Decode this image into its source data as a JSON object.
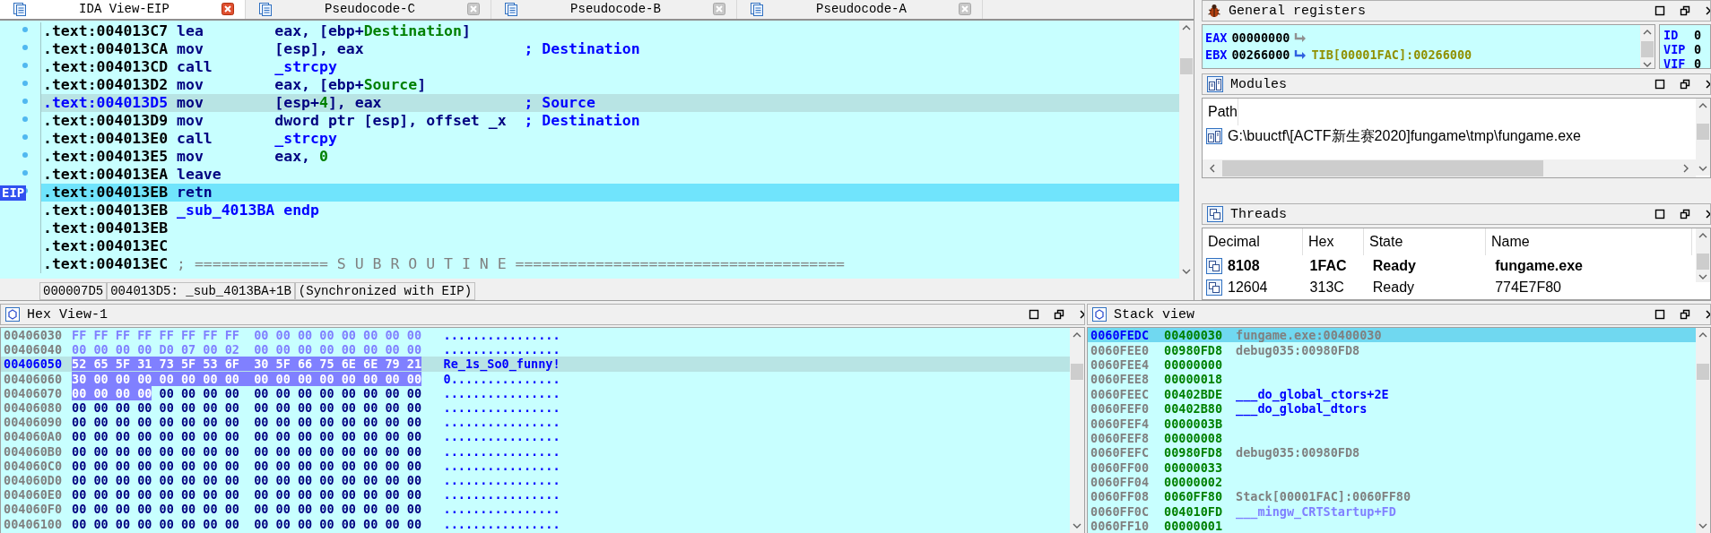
{
  "ida_view": {
    "tabs": [
      {
        "label": "IDA View-EIP",
        "selected": true
      },
      {
        "label": "Pseudocode-C",
        "selected": false
      },
      {
        "label": "Pseudocode-B",
        "selected": false
      },
      {
        "label": "Pseudocode-A",
        "selected": false
      }
    ],
    "eip_label": "EIP",
    "lines": [
      {
        "address": ".text:004013C7",
        "mnemonic": "lea",
        "kind": "instruction",
        "operands": [
          {
            "text": "eax, [ebp+",
            "kind": "plain"
          },
          {
            "text": "Destination",
            "kind": "name"
          },
          {
            "text": "]",
            "kind": "plain"
          }
        ],
        "marked": true,
        "selected": false,
        "current": false
      },
      {
        "address": ".text:004013CA",
        "mnemonic": "mov",
        "kind": "instruction",
        "operands": [
          {
            "text": "[esp], eax",
            "kind": "plain"
          }
        ],
        "comment": "; Destination",
        "marked": true,
        "selected": false,
        "current": false
      },
      {
        "address": ".text:004013CD",
        "mnemonic": "call",
        "kind": "instruction",
        "operands": [
          {
            "text": "_strcpy",
            "kind": "ref"
          }
        ],
        "marked": true,
        "selected": false,
        "current": false
      },
      {
        "address": ".text:004013D2",
        "mnemonic": "mov",
        "kind": "instruction",
        "operands": [
          {
            "text": "eax, [ebp+",
            "kind": "plain"
          },
          {
            "text": "Source",
            "kind": "name"
          },
          {
            "text": "]",
            "kind": "plain"
          }
        ],
        "marked": true,
        "selected": false,
        "current": false
      },
      {
        "address": ".text:004013D5",
        "mnemonic": "mov",
        "kind": "instruction",
        "operands": [
          {
            "text": "[esp+",
            "kind": "plain"
          },
          {
            "text": "4",
            "kind": "num"
          },
          {
            "text": "], eax",
            "kind": "plain"
          }
        ],
        "comment": "; Source",
        "marked": true,
        "selected": true,
        "current": false
      },
      {
        "address": ".text:004013D9",
        "mnemonic": "mov",
        "kind": "instruction",
        "operands": [
          {
            "text": "dword ptr [esp], offset _x",
            "kind": "plain"
          }
        ],
        "comment": "; Destination",
        "marked": true,
        "selected": false,
        "current": false
      },
      {
        "address": ".text:004013E0",
        "mnemonic": "call",
        "kind": "instruction",
        "operands": [
          {
            "text": "_strcpy",
            "kind": "ref"
          }
        ],
        "marked": true,
        "selected": false,
        "current": false
      },
      {
        "address": ".text:004013E5",
        "mnemonic": "mov",
        "kind": "instruction",
        "operands": [
          {
            "text": "eax, ",
            "kind": "plain"
          },
          {
            "text": "0",
            "kind": "num"
          }
        ],
        "marked": true,
        "selected": false,
        "current": false
      },
      {
        "address": ".text:004013EA",
        "mnemonic": "leave",
        "kind": "instruction",
        "marked": true,
        "selected": false,
        "current": false
      },
      {
        "address": ".text:004013EB",
        "mnemonic": "retn",
        "kind": "instruction",
        "marked": true,
        "selected": false,
        "current": true
      },
      {
        "address": ".text:004013EB",
        "mnemonic": "_sub_4013BA endp",
        "kind": "label",
        "marked": false,
        "selected": false,
        "current": false
      },
      {
        "address": ".text:004013EB",
        "marked": false,
        "selected": false,
        "current": false
      },
      {
        "address": ".text:004013EC",
        "marked": false,
        "selected": false,
        "current": false
      },
      {
        "address": ".text:004013EC",
        "mnemonic": "; =============== S U B R O U T I N E =====================================",
        "kind": "separator",
        "marked": false,
        "selected": false,
        "current": false
      }
    ],
    "status": [
      "000007D5",
      "004013D5: _sub_4013BA+1B",
      "(Synchronized with EIP)"
    ]
  },
  "registers": {
    "title": "General registers",
    "rows": [
      {
        "name": "EAX",
        "value": "00000000",
        "pointer": false
      },
      {
        "name": "EBX",
        "value": "00266000",
        "pointer": true,
        "target": "TIB[00001FAC]:00266000"
      }
    ],
    "flags": [
      {
        "name": "ID",
        "value": "0"
      },
      {
        "name": "VIP",
        "value": "0"
      },
      {
        "name": "VIF",
        "value": "0"
      }
    ]
  },
  "modules": {
    "title": "Modules",
    "columns": [
      "Path"
    ],
    "rows": [
      {
        "path": "G:\\buuctf\\[ACTF新生赛2020]fungame\\tmp\\fungame.exe"
      }
    ]
  },
  "threads": {
    "title": "Threads",
    "columns": [
      "Decimal",
      "Hex",
      "State",
      "Name"
    ],
    "rows": [
      {
        "cells": [
          "8108",
          "1FAC",
          "Ready",
          "fungame.exe"
        ],
        "current": true
      },
      {
        "cells": [
          "12604",
          "313C",
          "Ready",
          "774E7F80"
        ],
        "current": false
      }
    ]
  },
  "hex_view": {
    "title": "Hex View-1",
    "rows": [
      {
        "address": "00406030",
        "kind": "undefined",
        "groups": [
          {
            "text": "FF FF FF FF FF FF FF FF  00 00 00 00 00 00 00 00",
            "highlighted": false
          }
        ],
        "ascii": "................",
        "selected": false
      },
      {
        "address": "00406040",
        "kind": "undefined",
        "groups": [
          {
            "text": "00 00 00 00 D0 07 00 02  00 00 00 00 00 00 00 00",
            "highlighted": false
          }
        ],
        "ascii": "................",
        "selected": false
      },
      {
        "address": "00406050",
        "kind": "data",
        "groups": [
          {
            "text": "52 65 5F 31 73 5F 53 6F  30 5F 66 75 6E 6E 79 21",
            "highlighted": true
          }
        ],
        "ascii": "Re_1s_So0_funny!",
        "selected": true
      },
      {
        "address": "00406060",
        "kind": "data",
        "groups": [
          {
            "text": "30 00 00 00 00 00 00 00  00 00 00 00 00 00 00 00",
            "highlighted": true
          }
        ],
        "ascii": "0...............",
        "selected": false
      },
      {
        "address": "00406070",
        "kind": "data",
        "groups": [
          {
            "text": "00 00 00 00",
            "highlighted": true
          },
          {
            "text": "00 00 00 00  00 00 00 00 00 00 00 00",
            "highlighted": false
          }
        ],
        "ascii": "................",
        "selected": false
      },
      {
        "address": "00406080",
        "kind": "data",
        "groups": [
          {
            "text": "00 00 00 00 00 00 00 00  00 00 00 00 00 00 00 00",
            "highlighted": false
          }
        ],
        "ascii": "................",
        "selected": false
      },
      {
        "address": "00406090",
        "kind": "data",
        "groups": [
          {
            "text": "00 00 00 00 00 00 00 00  00 00 00 00 00 00 00 00",
            "highlighted": false
          }
        ],
        "ascii": "................",
        "selected": false
      },
      {
        "address": "004060A0",
        "kind": "data",
        "groups": [
          {
            "text": "00 00 00 00 00 00 00 00  00 00 00 00 00 00 00 00",
            "highlighted": false
          }
        ],
        "ascii": "................",
        "selected": false
      },
      {
        "address": "004060B0",
        "kind": "data",
        "groups": [
          {
            "text": "00 00 00 00 00 00 00 00  00 00 00 00 00 00 00 00",
            "highlighted": false
          }
        ],
        "ascii": "................",
        "selected": false
      },
      {
        "address": "004060C0",
        "kind": "data",
        "groups": [
          {
            "text": "00 00 00 00 00 00 00 00  00 00 00 00 00 00 00 00",
            "highlighted": false
          }
        ],
        "ascii": "................",
        "selected": false
      },
      {
        "address": "004060D0",
        "kind": "data",
        "groups": [
          {
            "text": "00 00 00 00 00 00 00 00  00 00 00 00 00 00 00 00",
            "highlighted": false
          }
        ],
        "ascii": "................",
        "selected": false
      },
      {
        "address": "004060E0",
        "kind": "data",
        "groups": [
          {
            "text": "00 00 00 00 00 00 00 00  00 00 00 00 00 00 00 00",
            "highlighted": false
          }
        ],
        "ascii": "................",
        "selected": false
      },
      {
        "address": "004060F0",
        "kind": "data",
        "groups": [
          {
            "text": "00 00 00 00 00 00 00 00  00 00 00 00 00 00 00 00",
            "highlighted": false
          }
        ],
        "ascii": "................",
        "selected": false
      },
      {
        "address": "00406100",
        "kind": "data",
        "groups": [
          {
            "text": "00 00 00 00 00 00 00 00  00 00 00 00 00 00 00 00",
            "highlighted": false
          }
        ],
        "ascii": "................",
        "selected": false
      }
    ]
  },
  "stack_view": {
    "title": "Stack view",
    "rows": [
      {
        "address": "0060FEDC",
        "value": "00400030",
        "comment": "fungame.exe:00400030",
        "kind": "data",
        "selected": true
      },
      {
        "address": "0060FEE0",
        "value": "00980FD8",
        "comment": "debug035:00980FD8",
        "kind": "data",
        "selected": false
      },
      {
        "address": "0060FEE4",
        "value": "00000000",
        "selected": false
      },
      {
        "address": "0060FEE8",
        "value": "00000018",
        "selected": false
      },
      {
        "address": "0060FEEC",
        "value": "00402BDE",
        "comment": "___do_global_ctors+2E",
        "kind": "code",
        "selected": false
      },
      {
        "address": "0060FEF0",
        "value": "00402B80",
        "comment": "___do_global_dtors",
        "kind": "code",
        "selected": false
      },
      {
        "address": "0060FEF4",
        "value": "0000003B",
        "selected": false
      },
      {
        "address": "0060FEF8",
        "value": "00000008",
        "selected": false
      },
      {
        "address": "0060FEFC",
        "value": "00980FD8",
        "comment": "debug035:00980FD8",
        "kind": "data",
        "selected": false
      },
      {
        "address": "0060FF00",
        "value": "00000033",
        "selected": false
      },
      {
        "address": "0060FF04",
        "value": "00000002",
        "selected": false
      },
      {
        "address": "0060FF08",
        "value": "0060FF80",
        "comment": "Stack[00001FAC]:0060FF80",
        "kind": "data",
        "selected": false
      },
      {
        "address": "0060FF0C",
        "value": "004010FD",
        "comment": "___mingw_CRTStartup+FD",
        "kind": "library",
        "selected": false
      },
      {
        "address": "0060FF10",
        "value": "00000001",
        "selected": false
      }
    ]
  }
}
